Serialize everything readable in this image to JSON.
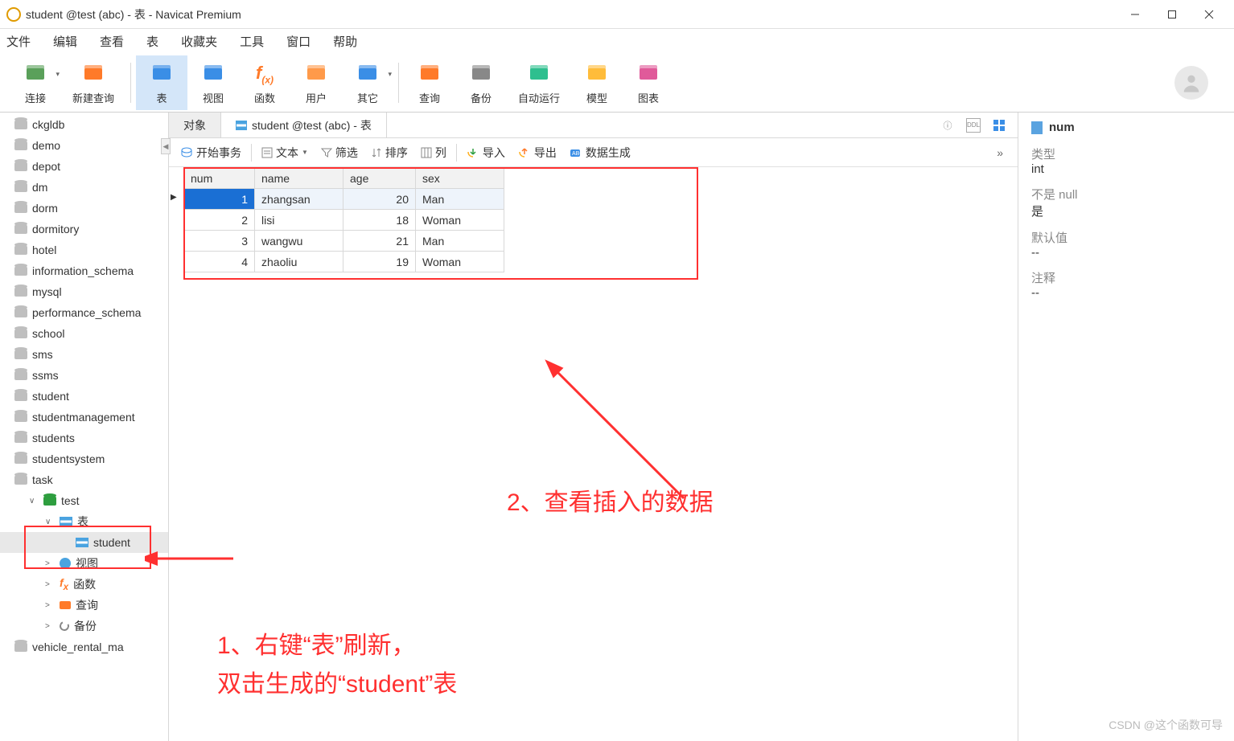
{
  "title": "student @test (abc) - 表 - Navicat Premium",
  "menu": [
    "文件",
    "编辑",
    "查看",
    "表",
    "收藏夹",
    "工具",
    "窗口",
    "帮助"
  ],
  "toolbar": [
    {
      "label": "连接",
      "color": "#5aa05a",
      "chev": true
    },
    {
      "label": "新建查询",
      "color": "#ff7a29"
    },
    {
      "sep": true
    },
    {
      "label": "表",
      "color": "#3a8ee6",
      "active": true
    },
    {
      "label": "视图",
      "color": "#3a8ee6"
    },
    {
      "label": "函数",
      "color": "#ff7a29",
      "fx": true
    },
    {
      "label": "用户",
      "color": "#ff9a4a"
    },
    {
      "label": "其它",
      "color": "#3a8ee6",
      "chev": true
    },
    {
      "sep": true
    },
    {
      "label": "查询",
      "color": "#ff7a29"
    },
    {
      "label": "备份",
      "color": "#888"
    },
    {
      "label": "自动运行",
      "color": "#2ebf8f"
    },
    {
      "label": "模型",
      "color": "#ffbc3a"
    },
    {
      "label": "图表",
      "color": "#e05a9a"
    }
  ],
  "tree": [
    {
      "label": "ckgldb",
      "icon": "db"
    },
    {
      "label": "demo",
      "icon": "db"
    },
    {
      "label": "depot",
      "icon": "db"
    },
    {
      "label": "dm",
      "icon": "db"
    },
    {
      "label": "dorm",
      "icon": "db"
    },
    {
      "label": "dormitory",
      "icon": "db"
    },
    {
      "label": "hotel",
      "icon": "db"
    },
    {
      "label": "information_schema",
      "icon": "db"
    },
    {
      "label": "mysql",
      "icon": "db"
    },
    {
      "label": "performance_schema",
      "icon": "db"
    },
    {
      "label": "school",
      "icon": "db"
    },
    {
      "label": "sms",
      "icon": "db"
    },
    {
      "label": "ssms",
      "icon": "db"
    },
    {
      "label": "student",
      "icon": "db"
    },
    {
      "label": "studentmanagement",
      "icon": "db"
    },
    {
      "label": "students",
      "icon": "db"
    },
    {
      "label": "studentsystem",
      "icon": "db"
    },
    {
      "label": "task",
      "icon": "db"
    },
    {
      "label": "test",
      "icon": "dbgreen",
      "chev": "∨",
      "lvl": 1
    },
    {
      "label": "表",
      "icon": "tbl",
      "chev": "∨",
      "lvl": 2
    },
    {
      "label": "student",
      "icon": "tbl",
      "lvl": 3,
      "selected": true
    },
    {
      "label": "视图",
      "icon": "view",
      "chev": ">",
      "lvl": 2
    },
    {
      "label": "函数",
      "icon": "fn",
      "chev": ">",
      "lvl": 2
    },
    {
      "label": "查询",
      "icon": "q",
      "chev": ">",
      "lvl": 2
    },
    {
      "label": "备份",
      "icon": "bk",
      "chev": ">",
      "lvl": 2
    },
    {
      "label": "vehicle_rental_ma",
      "icon": "db"
    }
  ],
  "tabs": {
    "objects": "对象",
    "active": "student @test (abc) - 表"
  },
  "datatb": {
    "begin": "开始事务",
    "text": "文本",
    "filter": "筛选",
    "sort": "排序",
    "col": "列",
    "import": "导入",
    "export": "导出",
    "gen": "数据生成"
  },
  "columns": [
    "num",
    "name",
    "age",
    "sex"
  ],
  "rows": [
    {
      "num": "1",
      "name": "zhangsan",
      "age": "20",
      "sex": "Man"
    },
    {
      "num": "2",
      "name": "lisi",
      "age": "18",
      "sex": "Woman"
    },
    {
      "num": "3",
      "name": "wangwu",
      "age": "21",
      "sex": "Man"
    },
    {
      "num": "4",
      "name": "zhaoliu",
      "age": "19",
      "sex": "Woman"
    }
  ],
  "rightpanel": {
    "header": "num",
    "l_type": "类型",
    "v_type": "int",
    "l_notnull": "不是 null",
    "v_notnull": "是",
    "l_default": "默认值",
    "v_default": "--",
    "l_comment": "注释",
    "v_comment": "--"
  },
  "anno1_l1": "1、右键“表”刷新，",
  "anno1_l2": "双击生成的“student”表",
  "anno2": "2、查看插入的数据",
  "watermark": "CSDN @这个函数可导"
}
